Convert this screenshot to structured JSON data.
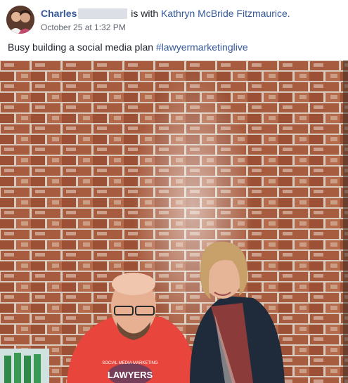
{
  "post": {
    "author": "Charles",
    "with_text": "is with",
    "tagged_person": "Kathryn McBride Fitzmaurice.",
    "timestamp": "October 25 at 1:32 PM",
    "message": "Busy building a social media plan",
    "hashtag": "#lawyermarketinglive",
    "shirt_text": "LAWYERS",
    "shirt_arc_text": "SOCIAL MEDIA MARKETING"
  },
  "colors": {
    "link": "#365899",
    "text": "#1d2129",
    "meta": "#616770",
    "brick": "#a45a3c",
    "shirt": "#e8453c"
  }
}
